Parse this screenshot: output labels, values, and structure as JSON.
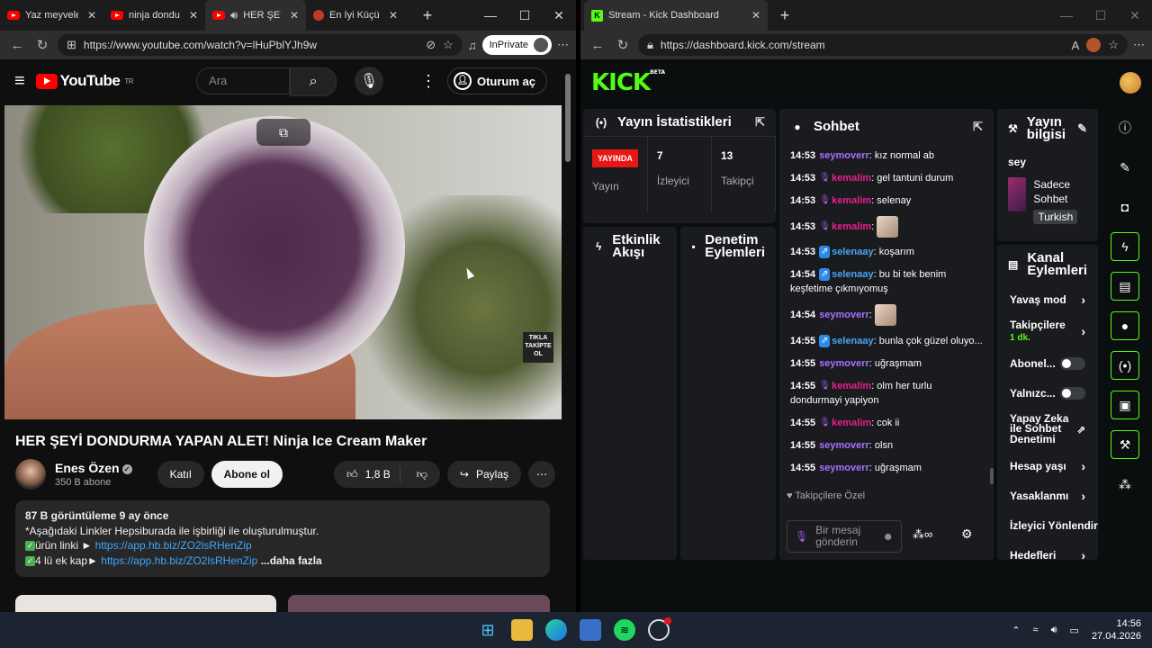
{
  "left_browser": {
    "tabs": [
      {
        "title": "Yaz meyveleriı",
        "active": false
      },
      {
        "title": "ninja dondurm",
        "active": false
      },
      {
        "title": "HER ŞEYİ",
        "active": true
      },
      {
        "title": "En İyi Küçük Ev",
        "active": false
      }
    ],
    "url": "https://www.youtube.com/watch?v=lHuPblYJh9w",
    "inprivate_label": "InPrivate"
  },
  "youtube": {
    "logo_text": "YouTube",
    "region": "TR",
    "search_placeholder": "Ara",
    "signin_label": "Oturum aç",
    "overlay_badge": "TIKLA TAKİPTE OL",
    "video_title": "HER ŞEYİ DONDURMA YAPAN ALET! Ninja Ice Cream Maker",
    "channel_name": "Enes Özen",
    "subscribers": "350 B abone",
    "join_label": "Katıl",
    "subscribe_label": "Abone ol",
    "like_count": "1,8 B",
    "share_label": "Paylaş",
    "description": {
      "stats": "87 B görüntüleme  9 ay önce",
      "line1": "*Aşağıdaki Linkler Hepsiburada ile işbirliği ile oluşturulmuştur.",
      "line2_text": "ürün linki ►",
      "line2_link": "https://app.hb.biz/ZO2lsRHenZip",
      "line3_text": "4 lü ek kap►",
      "line3_link": "https://app.hb.biz/ZO2lsRHenZip",
      "more": "...daha fazla"
    }
  },
  "right_browser": {
    "tab_title": "Stream - Kick Dashboard",
    "url": "https://dashboard.kick.com/stream"
  },
  "kick": {
    "logo_text": "KICK",
    "logo_badge": "BETA",
    "stats_panel": {
      "title": "Yayın İstatistikleri",
      "live_label": "YAYINDA",
      "stream_label": "Yayın",
      "viewers": "7",
      "viewers_label": "İzleyici",
      "followers": "13",
      "followers_label": "Takipçi"
    },
    "activity_title": "Etkinlik Akışı",
    "moderation_title": "Denetim Eylemleri",
    "chat": {
      "title": "Sohbet",
      "messages": [
        {
          "time": "14:53",
          "user": "seymoverr",
          "color": "#a970ff",
          "badge": "",
          "text": "kız normal ab"
        },
        {
          "time": "14:53",
          "user": "kemalim",
          "color": "#e91e8c",
          "badge": "mic",
          "text": "gel tantuni durum"
        },
        {
          "time": "14:53",
          "user": "kemalim",
          "color": "#e91e8c",
          "badge": "mic",
          "text": "selenay"
        },
        {
          "time": "14:53",
          "user": "kemalim",
          "color": "#e91e8c",
          "badge": "mic",
          "text": "",
          "emote": true
        },
        {
          "time": "14:53",
          "user": "selenaay",
          "color": "#4aa3f0",
          "badge": "sub",
          "text": "koşarım"
        },
        {
          "time": "14:54",
          "user": "selenaay",
          "color": "#4aa3f0",
          "badge": "sub",
          "text": "bu bi tek benim keşfetime çıkmıyomuş"
        },
        {
          "time": "14:54",
          "user": "seymoverr",
          "color": "#a970ff",
          "badge": "",
          "text": "",
          "emote": true
        },
        {
          "time": "14:55",
          "user": "selenaay",
          "color": "#4aa3f0",
          "badge": "sub",
          "text": "bunla çok güzel oluyo..."
        },
        {
          "time": "14:55",
          "user": "seymoverr",
          "color": "#a970ff",
          "badge": "",
          "text": "uğraşmam"
        },
        {
          "time": "14:55",
          "user": "kemalim",
          "color": "#e91e8c",
          "badge": "mic",
          "text": "olm her turlu dondurmayi yapiyon"
        },
        {
          "time": "14:55",
          "user": "kemalim",
          "color": "#e91e8c",
          "badge": "mic",
          "text": "cok ii"
        },
        {
          "time": "14:55",
          "user": "seymoverr",
          "color": "#a970ff",
          "badge": "",
          "text": "olsn"
        },
        {
          "time": "14:55",
          "user": "seymoverr",
          "color": "#a970ff",
          "badge": "",
          "text": "uğraşmam"
        }
      ],
      "followers_only": "Takipçilere Özel",
      "input_placeholder": "Bir mesaj gönderin"
    },
    "stream_info": {
      "title": "Yayın bilgisi",
      "stream_title": "sey",
      "category": "Sadece Sohbet",
      "language": "Turkish"
    },
    "channel_actions": {
      "title": "Kanal Eylemleri",
      "slow_mode": "Yavaş mod",
      "followers_only": "Takipçilere",
      "followers_duration": "1 dk.",
      "subscribers_only": "Abonel...",
      "emotes_only": "Yalnızc...",
      "ai_moderation": "Yapay Zeka ile Sohbet Denetimi",
      "account_age": "Hesap yaşı",
      "banned": "Yasaklanmı",
      "viewer_redirect": "İzleyici Yönlendir",
      "goals": "Hedefleri"
    }
  },
  "taskbar": {
    "time": "14:56",
    "date": "27.04.2026"
  },
  "colors": {
    "kick_green": "#53fc18",
    "youtube_red": "#ff0000",
    "live_red": "#e81717"
  }
}
